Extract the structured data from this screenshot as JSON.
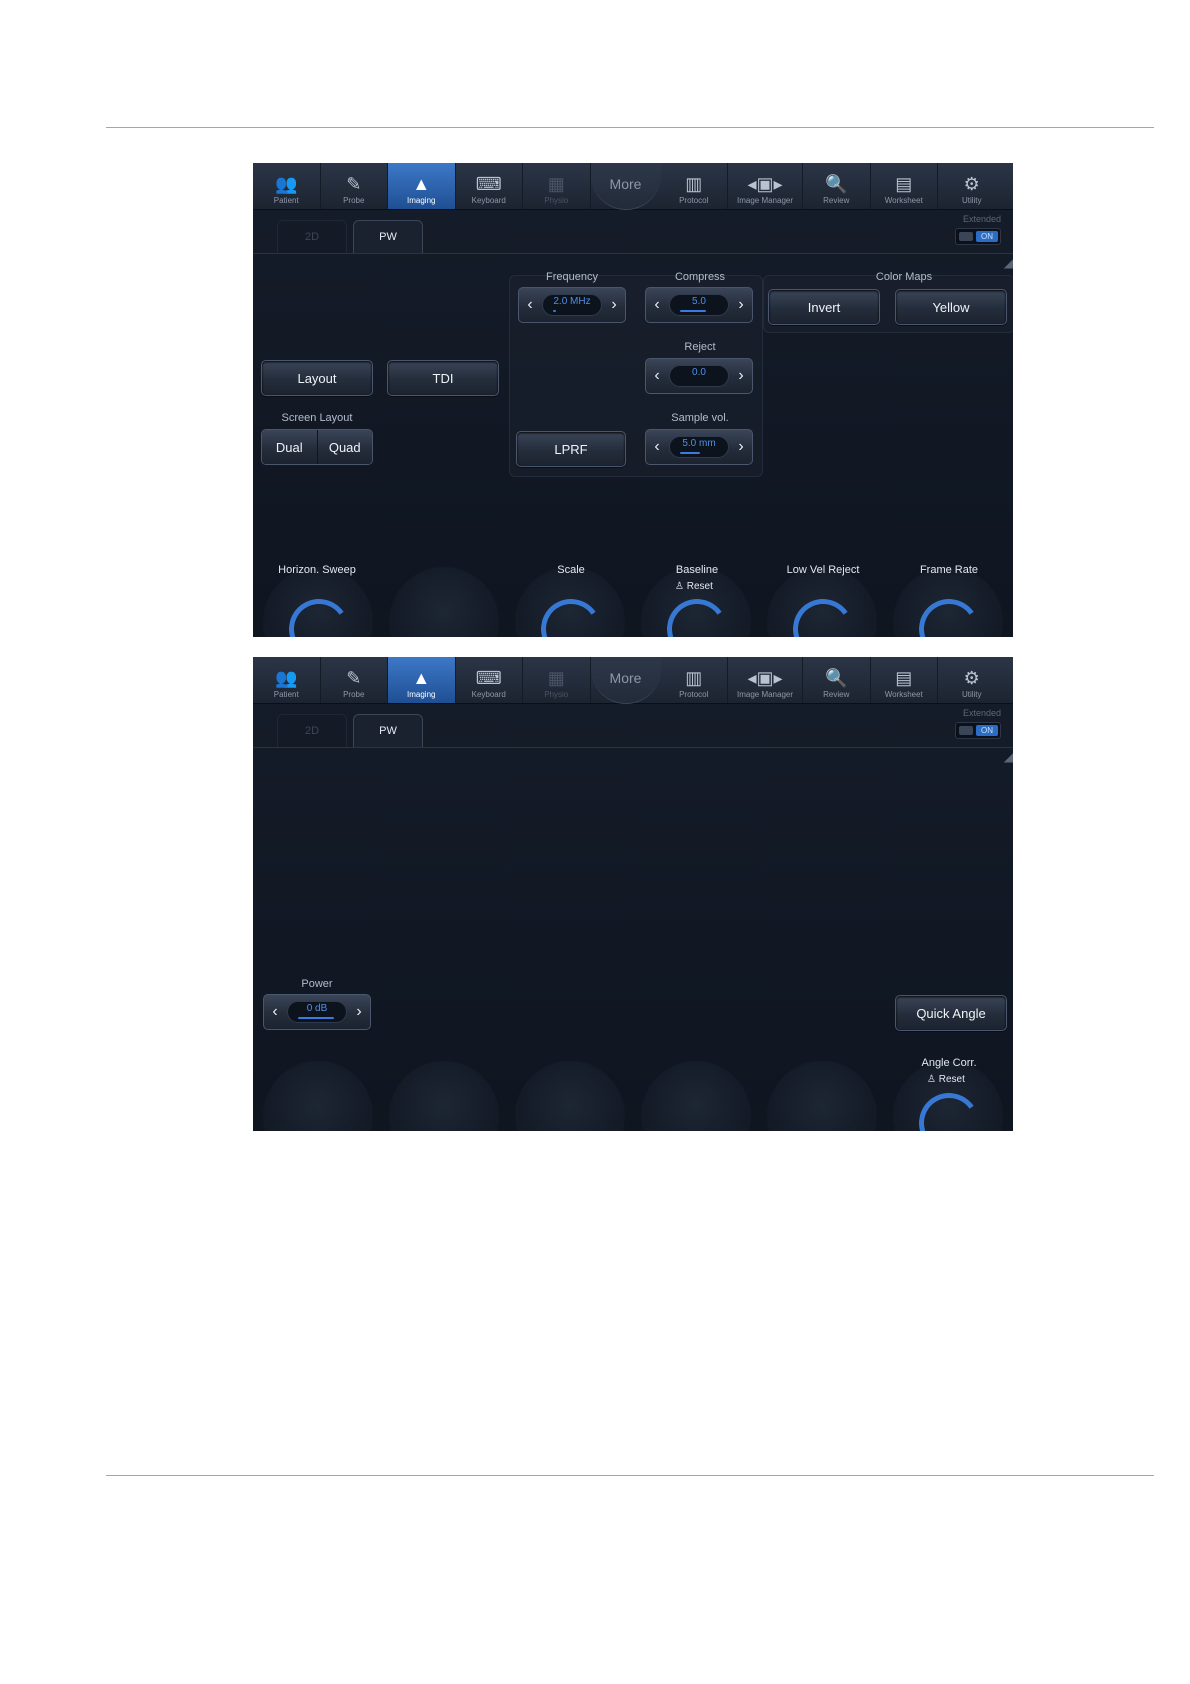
{
  "toolbar": {
    "items": [
      {
        "label": "Patient",
        "icon": "patient-icon",
        "glyph": "👥"
      },
      {
        "label": "Probe",
        "icon": "probe-icon",
        "glyph": "✎"
      },
      {
        "label": "Imaging",
        "icon": "imaging-icon",
        "glyph": "▲"
      },
      {
        "label": "Keyboard",
        "icon": "keyboard-icon",
        "glyph": "⌨"
      },
      {
        "label": "Physio",
        "icon": "physio-icon",
        "glyph": "▦"
      },
      {
        "label": "More"
      },
      {
        "label": "Protocol",
        "icon": "protocol-icon",
        "glyph": "▥"
      },
      {
        "label": "Image Manager",
        "icon": "image-manager-icon",
        "glyph": "◂▣▸"
      },
      {
        "label": "Review",
        "icon": "review-icon",
        "glyph": "🔍"
      },
      {
        "label": "Worksheet",
        "icon": "worksheet-icon",
        "glyph": "▤"
      },
      {
        "label": "Utility",
        "icon": "utility-icon",
        "glyph": "⚙"
      }
    ]
  },
  "tabs": {
    "inactive": "2D",
    "active": "PW"
  },
  "extended": {
    "label": "Extended",
    "state": "ON"
  },
  "screen1": {
    "frequency": {
      "label": "Frequency",
      "value": "2.0 MHz"
    },
    "compress": {
      "label": "Compress",
      "value": "5.0"
    },
    "reject": {
      "label": "Reject",
      "value": "0.0"
    },
    "sample_vol": {
      "label": "Sample vol.",
      "value": "5.0 mm"
    },
    "color_maps": {
      "label": "Color Maps",
      "invert": "Invert",
      "yellow": "Yellow"
    },
    "layout": "Layout",
    "tdi": "TDI",
    "screen_layout": {
      "label": "Screen Layout",
      "dual": "Dual",
      "quad": "Quad"
    },
    "lprf": "LPRF",
    "knobs": {
      "horizon_sweep": "Horizon. Sweep",
      "scale": "Scale",
      "baseline": "Baseline",
      "baseline_reset": "Reset",
      "low_vel_reject": "Low Vel Reject",
      "frame_rate": "Frame Rate"
    }
  },
  "screen2": {
    "power": {
      "label": "Power",
      "value": "0 dB"
    },
    "quick_angle": "Quick Angle",
    "angle_corr": "Angle Corr.",
    "angle_corr_reset": "Reset"
  },
  "colors": {
    "accent": "#2b6cc4",
    "value_text": "#4f8fe6",
    "panel": "#161d2a"
  }
}
